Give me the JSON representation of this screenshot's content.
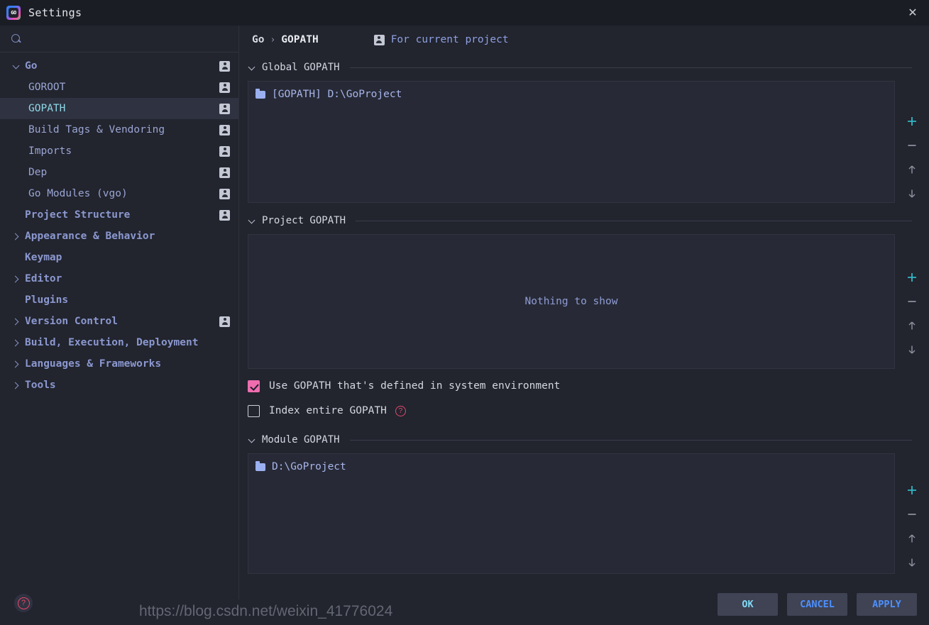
{
  "window": {
    "title": "Settings",
    "logo_icon": "goland-logo-icon",
    "close_icon": "close-icon"
  },
  "sidebar": {
    "search": {
      "placeholder": "",
      "value": "",
      "icon": "search-icon"
    },
    "items": [
      {
        "label": "Go",
        "level": 0,
        "arrow": "down",
        "badge": true,
        "selected": false
      },
      {
        "label": "GOROOT",
        "level": 1,
        "arrow": "none",
        "badge": true,
        "selected": false
      },
      {
        "label": "GOPATH",
        "level": 1,
        "arrow": "none",
        "badge": true,
        "selected": true
      },
      {
        "label": "Build Tags & Vendoring",
        "level": 1,
        "arrow": "none",
        "badge": true,
        "selected": false
      },
      {
        "label": "Imports",
        "level": 1,
        "arrow": "none",
        "badge": true,
        "selected": false
      },
      {
        "label": "Dep",
        "level": 1,
        "arrow": "none",
        "badge": true,
        "selected": false
      },
      {
        "label": "Go Modules (vgo)",
        "level": 1,
        "arrow": "none",
        "badge": true,
        "selected": false
      },
      {
        "label": "Project Structure",
        "level": 0,
        "arrow": "none",
        "badge": true,
        "selected": false
      },
      {
        "label": "Appearance & Behavior",
        "level": 0,
        "arrow": "right",
        "badge": false,
        "selected": false
      },
      {
        "label": "Keymap",
        "level": 0,
        "arrow": "none",
        "badge": false,
        "selected": false
      },
      {
        "label": "Editor",
        "level": 0,
        "arrow": "right",
        "badge": false,
        "selected": false
      },
      {
        "label": "Plugins",
        "level": 0,
        "arrow": "none",
        "badge": false,
        "selected": false
      },
      {
        "label": "Version Control",
        "level": 0,
        "arrow": "right",
        "badge": true,
        "selected": false
      },
      {
        "label": "Build, Execution, Deployment",
        "level": 0,
        "arrow": "right",
        "badge": false,
        "selected": false
      },
      {
        "label": "Languages & Frameworks",
        "level": 0,
        "arrow": "right",
        "badge": false,
        "selected": false
      },
      {
        "label": "Tools",
        "level": 0,
        "arrow": "right",
        "badge": false,
        "selected": false
      }
    ]
  },
  "main": {
    "breadcrumb": {
      "root": "Go",
      "separator": "›",
      "current": "GOPATH"
    },
    "for_current_project": {
      "label": "For current project",
      "icon": "project-badge-icon"
    },
    "sections": [
      {
        "title": "Global GOPATH",
        "rows": [
          {
            "text": "[GOPATH] D:\\GoProject",
            "icon": "folder-icon"
          }
        ],
        "empty_text": ""
      },
      {
        "title": "Project GOPATH",
        "rows": [],
        "empty_text": "Nothing to show"
      },
      {
        "title": "Module GOPATH",
        "rows": [
          {
            "text": "D:\\GoProject",
            "icon": "folder-icon"
          }
        ],
        "empty_text": ""
      }
    ],
    "toolbar_buttons": [
      {
        "name": "add-button",
        "glyph": "+",
        "color": "#31b9c6"
      },
      {
        "name": "remove-button",
        "glyph": "−",
        "color": "#8a8f9b"
      },
      {
        "name": "move-up-button",
        "glyph": "↑",
        "color": "#8a8f9b"
      },
      {
        "name": "move-down-button",
        "glyph": "↓",
        "color": "#8a8f9b"
      }
    ],
    "checkboxes": [
      {
        "label": "Use GOPATH that's defined in system environment",
        "checked": true,
        "help": false
      },
      {
        "label": "Index entire GOPATH",
        "checked": false,
        "help": true,
        "help_glyph": "?"
      }
    ]
  },
  "footer": {
    "help_button": {
      "name": "help-button",
      "glyph": "?"
    },
    "buttons": [
      {
        "label": "OK",
        "primary": true
      },
      {
        "label": "CANCEL",
        "primary": false
      },
      {
        "label": "APPLY",
        "primary": false
      }
    ]
  },
  "watermark": {
    "text": "https://blog.csdn.net/weixin_41776024"
  },
  "colors": {
    "accent_add": "#31b9c6",
    "checkbox_on": "#ef6daf",
    "help_red": "#e8476b",
    "link_blue": "#4d90fe",
    "primary_btn_text": "#7fd9f5",
    "panel_bg": "#272a36",
    "window_bg": "#22242e",
    "titlebar_bg": "#1b1d25",
    "selected_row": "#2f3240"
  }
}
